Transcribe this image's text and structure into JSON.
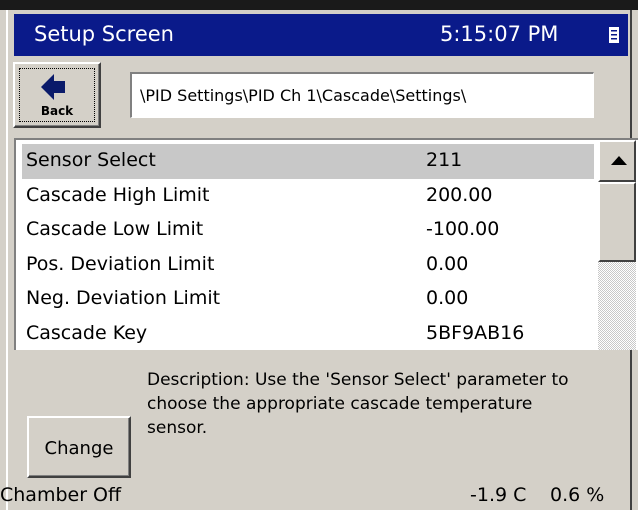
{
  "header": {
    "title": "Setup Screen",
    "time": "5:15:07 PM",
    "menu_icon": "document-icon"
  },
  "toolbar": {
    "back_label": "Back",
    "back_icon": "left-arrow-icon",
    "path": "\\PID Settings\\PID Ch 1\\Cascade\\Settings\\"
  },
  "parameters": [
    {
      "label": "Sensor Select",
      "value": "211",
      "selected": true
    },
    {
      "label": "Cascade High Limit",
      "value": "200.00"
    },
    {
      "label": "Cascade Low Limit",
      "value": "-100.00"
    },
    {
      "label": "Pos. Deviation Limit",
      "value": "0.00"
    },
    {
      "label": "Neg. Deviation Limit",
      "value": "0.00"
    },
    {
      "label": "Cascade Key",
      "value": "5BF9AB16"
    }
  ],
  "description": "Description:  Use the 'Sensor Select' parameter to\nchoose the appropriate cascade temperature\nsensor.",
  "change_label": "Change",
  "status": {
    "chamber": "Chamber Off",
    "temperature": "-1.9 C",
    "percent": "0.6 %"
  },
  "colors": {
    "titlebar": "#0a1a8a",
    "background": "#d4d0c8",
    "selected_row": "#c8c8c8"
  }
}
